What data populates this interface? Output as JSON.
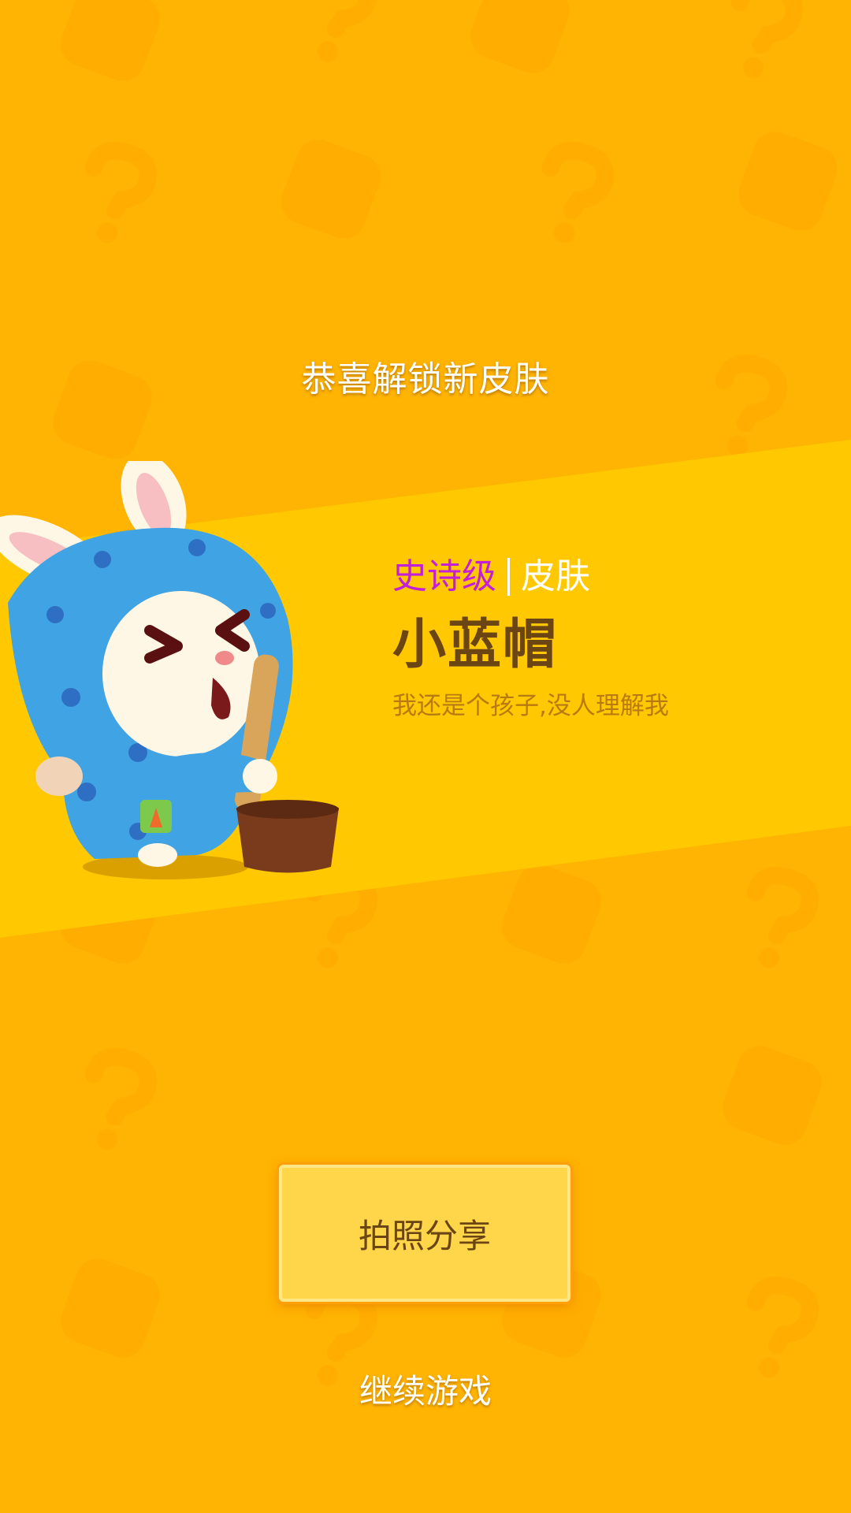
{
  "header": {
    "title": "恭喜解锁新皮肤"
  },
  "skin": {
    "rarity": "史诗级",
    "type": "皮肤",
    "name": "小蓝帽",
    "description": "我还是个孩子,没人理解我",
    "character_icon": "blue-hooded-rabbit-icon"
  },
  "actions": {
    "share_label": "拍照分享",
    "continue_label": "继续游戏"
  },
  "colors": {
    "background": "#FFB302",
    "banner": "#FFC800",
    "rarity": "#C41FD8",
    "name": "#6B4513",
    "description": "#B97A10",
    "button_fill": "#FFD54A"
  }
}
